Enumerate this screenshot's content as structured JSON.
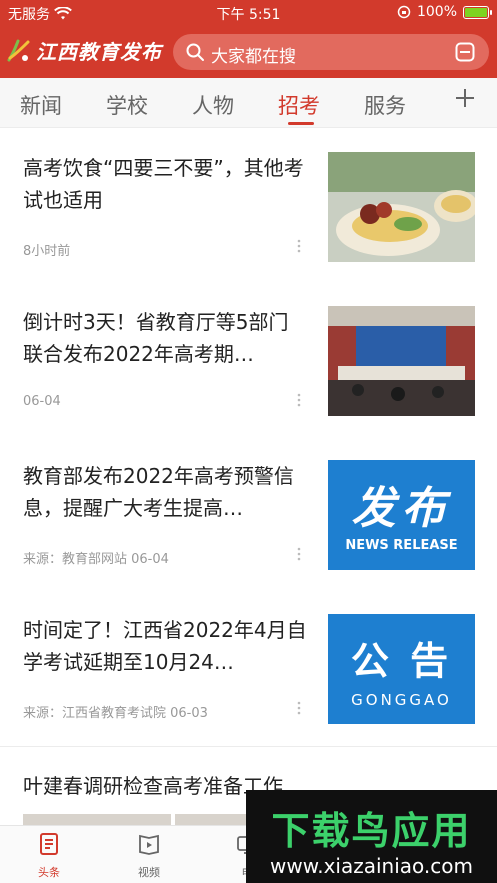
{
  "statusbar": {
    "carrier": "无服务",
    "time": "下午 5:51",
    "battery": "100%"
  },
  "appbar": {
    "logo_text": "江西教育发布",
    "search_placeholder": "大家都在搜"
  },
  "tabs": [
    {
      "label": "新闻"
    },
    {
      "label": "学校"
    },
    {
      "label": "人物"
    },
    {
      "label": "招考"
    },
    {
      "label": "服务"
    }
  ],
  "active_tab": "招考",
  "news": [
    {
      "title": "高考饮食“四要三不要”，其他考试也适用",
      "meta": "8小时前"
    },
    {
      "title": "倒计时3天！省教育厅等5部门联合发布2022年高考期…",
      "meta": "06-04"
    },
    {
      "title": "教育部发布2022年高考预警信息，提醒广大考生提高…",
      "meta": "来源：教育部网站  06-04",
      "thumb_big": "发布",
      "thumb_small": "NEWS RELEASE"
    },
    {
      "title": "时间定了！江西省2022年4月自学考试延期至10月24…",
      "meta": "来源：江西省教育考试院  06-03",
      "thumb_big": "公 告",
      "thumb_small": "GONGGAO"
    }
  ],
  "partial_news": {
    "title": "叶建春调研检查高考准备工作"
  },
  "bottom_nav": [
    {
      "label": "头条"
    },
    {
      "label": "视频"
    },
    {
      "label": "电"
    }
  ],
  "watermark": {
    "big": "下载鸟应用",
    "url": "www.xiazainiao.com"
  },
  "colors": {
    "brand_red": "#d23a2c",
    "thumb_blue": "#1e7fd0",
    "watermark_green": "#3cd16b"
  }
}
